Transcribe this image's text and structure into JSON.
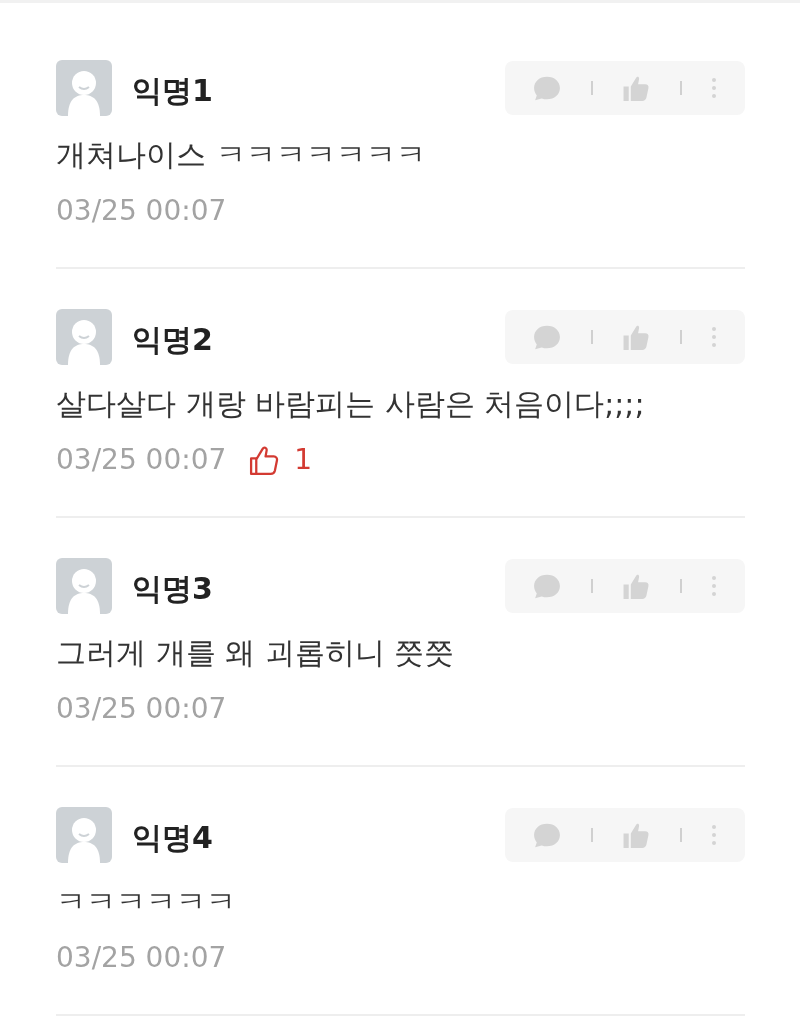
{
  "comments": [
    {
      "author": "익명1",
      "text": "개쳐나이스 ㅋㅋㅋㅋㅋㅋㅋ",
      "time": "03/25 00:07"
    },
    {
      "author": "익명2",
      "text": "살다살다 개랑 바람피는 사람은 처음이다;;;;",
      "time": "03/25 00:07",
      "likes": "1"
    },
    {
      "author": "익명3",
      "text": "그러게 개를 왜 괴롭히니 쯧쯧",
      "time": "03/25 00:07"
    },
    {
      "author": "익명4",
      "text": "ㅋㅋㅋㅋㅋㅋ",
      "time": "03/25 00:07"
    }
  ]
}
